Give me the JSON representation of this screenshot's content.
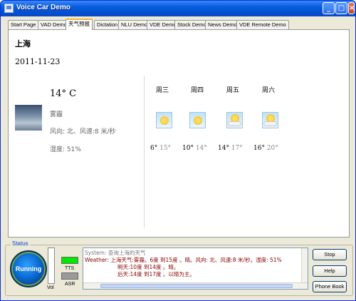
{
  "window": {
    "title": "Voice Car Demo",
    "minimize": "_",
    "maximize": "□",
    "close": "×"
  },
  "tabs": [
    {
      "label": "Start Page"
    },
    {
      "label": "VAD Demo"
    },
    {
      "label": "天气预报"
    },
    {
      "label": "Dictation"
    },
    {
      "label": "NLU Demo"
    },
    {
      "label": "VDE Demo"
    },
    {
      "label": "Stock Demo"
    },
    {
      "label": "News Demo"
    },
    {
      "label": "VDE Remote Demo"
    }
  ],
  "weather": {
    "city": "上海",
    "date": "2011-11-23",
    "temperature": "14° C",
    "condition": "雾霾",
    "wind": "风向:  北、风速:8 米/秒",
    "humidity": "湿度:  51%",
    "forecast": [
      {
        "day": "周三",
        "low": "6°",
        "high": "15°",
        "icon": "sunny-icon"
      },
      {
        "day": "周四",
        "low": "10°",
        "high": "14°",
        "icon": "sunny-icon"
      },
      {
        "day": "周五",
        "low": "14°",
        "high": "17°",
        "icon": "partly-cloudy-icon"
      },
      {
        "day": "周六",
        "low": "16°",
        "high": "20°",
        "icon": "partly-cloudy-icon"
      }
    ]
  },
  "status": {
    "label": "Status",
    "running": "Running",
    "vol": "Vol",
    "tts": "TTS",
    "asr": "ASR",
    "tts_color": "#00e800",
    "asr_color": "#9a9a9a",
    "log": [
      "System: 查询上海的天气",
      "Weather: 上海天气:雾霾。6度 到15度 。晴。风向: 北、风速:8 米/秒。湿度: 51%",
      "明天:10度 到14度 。晴。",
      "后天:14度 到17度 。以晴为主。"
    ],
    "buttons": {
      "stop": "Stop",
      "help": "Help",
      "phone_book": "Phone Book"
    }
  }
}
